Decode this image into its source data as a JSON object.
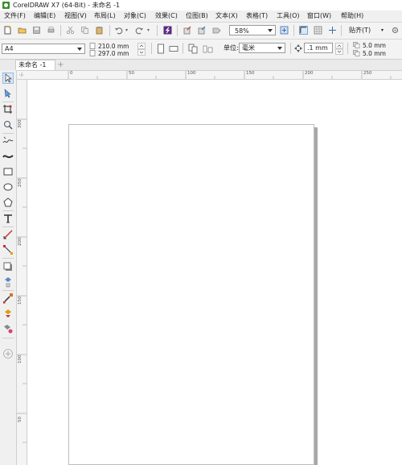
{
  "window": {
    "title": "CorelDRAW X7 (64-Bit) - 未命名 -1"
  },
  "menu": {
    "items": [
      "文件(F)",
      "编辑(E)",
      "视图(V)",
      "布局(L)",
      "对象(C)",
      "效果(C)",
      "位图(B)",
      "文本(X)",
      "表格(T)",
      "工具(O)",
      "窗口(W)",
      "帮助(H)"
    ]
  },
  "toolbar": {
    "zoom_value": "58%",
    "snap_label": "贴齐(T)"
  },
  "property_bar": {
    "page_size": "A4",
    "width": "210.0 mm",
    "height": "297.0 mm",
    "units_label": "单位:",
    "units_value": "毫米",
    "nudge_value": ".1 mm",
    "dup_x": "5.0 mm",
    "dup_y": "5.0 mm"
  },
  "document": {
    "tab_label": "未命名 -1"
  },
  "rulers": {
    "horizontal_labels": [
      "0",
      "50",
      "100",
      "150",
      "200",
      "250"
    ],
    "vertical_labels": [
      "300",
      "250",
      "200",
      "150",
      "100",
      "50"
    ]
  },
  "colors": {
    "accent": "#3a8d2b",
    "background": "#ffffff",
    "chrome": "#f0f0f0"
  }
}
